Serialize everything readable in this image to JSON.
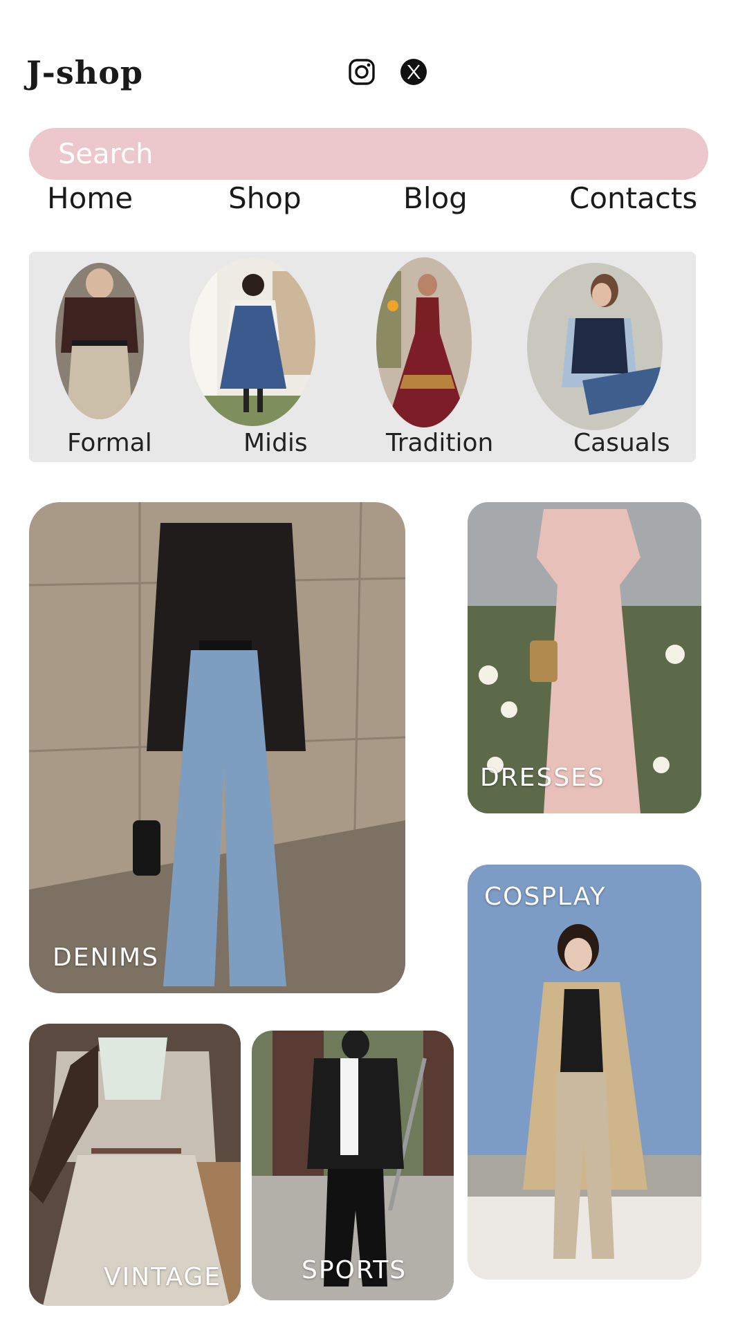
{
  "header": {
    "logo": "J-shop",
    "social": [
      {
        "icon": "instagram-icon"
      },
      {
        "icon": "x-icon"
      }
    ]
  },
  "search": {
    "placeholder": "Search"
  },
  "nav": {
    "items": [
      "Home",
      "Shop",
      "Blog",
      "Contacts"
    ]
  },
  "categories": [
    {
      "label": "Formal"
    },
    {
      "label": "Midis"
    },
    {
      "label": "Tradition"
    },
    {
      "label": "Casuals"
    }
  ],
  "tiles": {
    "denims": "DENIMS",
    "dresses": "DRESSES",
    "cosplay": "COSPLAY",
    "vintage": "VINTAGE",
    "sports": "SPORTS"
  },
  "colors": {
    "search_bg": "#ecc7cb",
    "panel_bg": "#e8e8e8"
  }
}
